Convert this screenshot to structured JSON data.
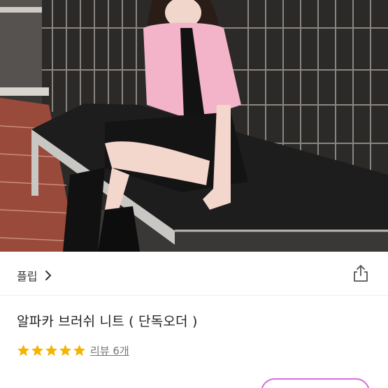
{
  "store": {
    "name": "플립",
    "chevron_icon": "chevron-right-icon"
  },
  "share": {
    "icon": "share-icon"
  },
  "product": {
    "title": "알파카 브러쉬 니트 ( 단독오더 )"
  },
  "rating": {
    "stars": 5,
    "star_color": "#f5b400",
    "review_label": "리뷰 6개"
  },
  "colors": {
    "accent_pill_border": "#d96bd9"
  }
}
